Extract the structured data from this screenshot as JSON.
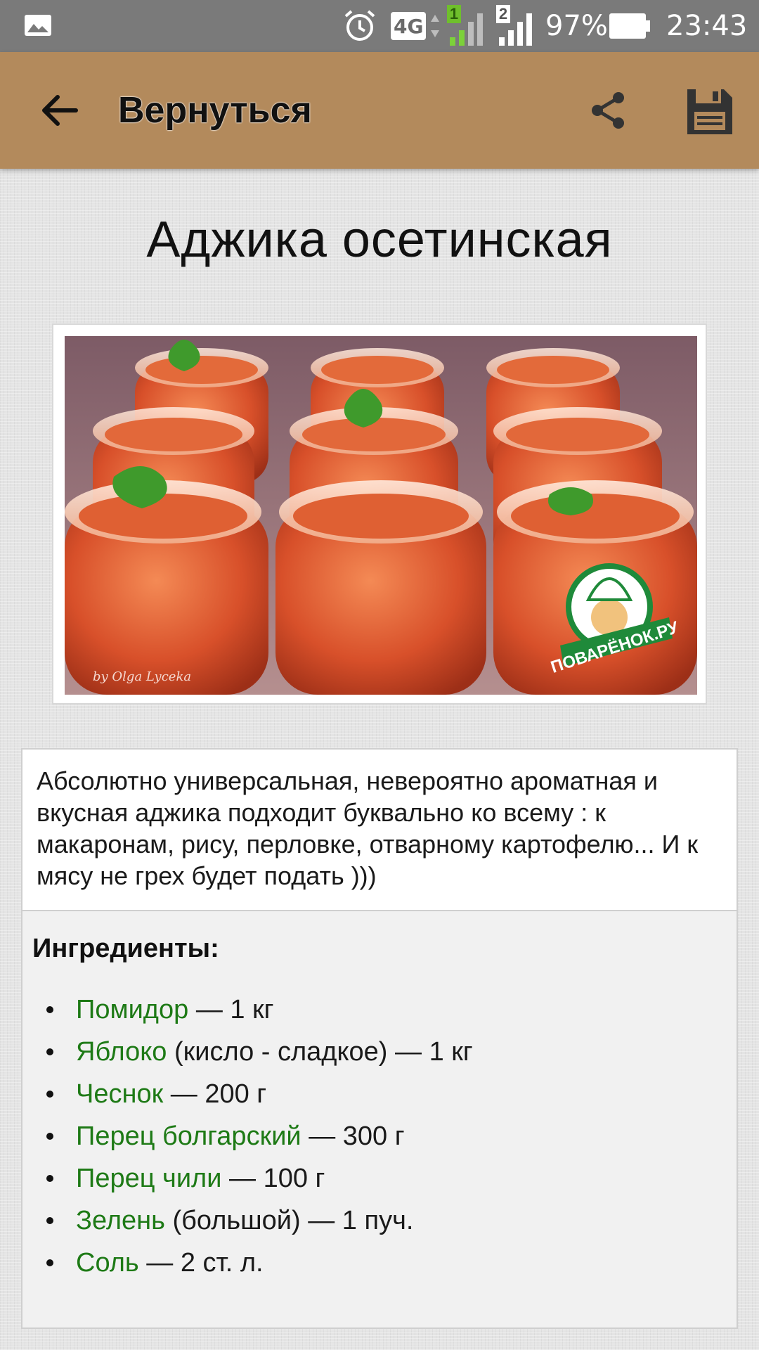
{
  "status_bar": {
    "network": "4G",
    "sim1": "1",
    "sim2": "2",
    "battery": "97%",
    "time": "23:43"
  },
  "app_bar": {
    "title": "Вернуться",
    "back_icon": "arrow-left-icon",
    "share_icon": "share-icon",
    "save_icon": "floppy-disk-icon"
  },
  "recipe": {
    "title": "Аджика осетинская",
    "description": "Абсолютно универсальная, невероятно ароматная и вкусная аджика подходит буквально ко всему : к макаронам, рису, перловке, отварному картофелю... И к мясу не грех будет подать )))",
    "photo": {
      "watermark_logo": "ПОВАРЁНОК.РУ",
      "signature": "by Olga Lyceka"
    }
  },
  "ingredients": {
    "heading": "Ингредиенты:",
    "items": [
      {
        "name": "Помидор",
        "note": "",
        "amount": "— 1 кг"
      },
      {
        "name": "Яблоко",
        "note": "(кисло - сладкое)",
        "amount": "— 1 кг"
      },
      {
        "name": "Чеснок",
        "note": "",
        "amount": "— 200 г"
      },
      {
        "name": "Перец болгарский",
        "note": "",
        "amount": "— 300 г"
      },
      {
        "name": "Перец чили",
        "note": "",
        "amount": "— 100 г"
      },
      {
        "name": "Зелень",
        "note": "(большой)",
        "amount": "— 1 пуч."
      },
      {
        "name": "Соль",
        "note": "",
        "amount": "— 2 ст. л."
      }
    ]
  },
  "colors": {
    "app_bar": "#b38a5c",
    "status_bar": "#7a7a7a",
    "ingredient_link": "#1e7a16"
  }
}
